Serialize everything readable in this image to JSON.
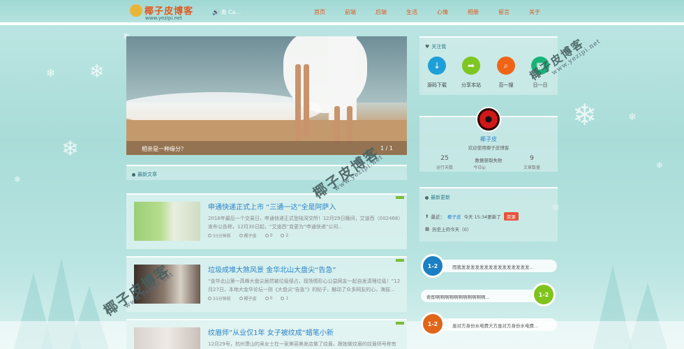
{
  "header": {
    "logo_title": "椰子皮博客",
    "logo_url": "www.yezipi.net",
    "music_text": "奥 Ca...",
    "nav": [
      "首页",
      "前端",
      "后端",
      "生活",
      "心情",
      "相册",
      "留言",
      "关于"
    ]
  },
  "slider": {
    "caption": "相亲是一种缘分？",
    "counter": "1 / 1"
  },
  "latest": {
    "title": "最新文章",
    "articles": [
      {
        "title": "申通快递正式上市 “三通一达”全是阿萨入",
        "excerpt": "2016年最后一个交易日，申通快递正式登陆深交所！12月29日晚间，艾迪西（002468）发布公告称，12月30日起，“艾迪西”变更为“申通快递”公司...",
        "time": "55分钟前",
        "author": "椰子皮",
        "views": "0",
        "comments": "2"
      },
      {
        "title": "垃圾成堆大煞风景 金华北山大盘尖“告急”",
        "excerpt": "“金华北山第一高峰大盘尖居然被垃圾侵占，现场情形心公益网友一起自发清理垃圾！”12月27日，本地大金华论坛一则《大盘尖“告急”》的帖子，触动了众多网友的心，海拔...",
        "time": "55分钟前",
        "author": "椰子皮",
        "views": "0",
        "comments": "1"
      },
      {
        "title": "纹眉师”从业仅1年 女子被纹成“蜡笔小新",
        "excerpt": "12月29号，杭州萧山的吴女士在一家美容美发店做了纹眉，跟她做纹眉的纹眉师号称有经",
        "time": "",
        "author": "",
        "views": "",
        "comments": ""
      }
    ]
  },
  "follow": {
    "title": "关注我",
    "items": [
      {
        "label": "源码下载",
        "icon": "download-icon",
        "color": "#1e9fd8",
        "glyph": "↓"
      },
      {
        "label": "分享本站",
        "icon": "share-icon",
        "color": "#7ec621",
        "glyph": "➦"
      },
      {
        "label": "百一搜",
        "icon": "search-icon",
        "color": "#f06417",
        "glyph": "⌕"
      },
      {
        "label": "日一日",
        "icon": "calendar-icon",
        "color": "#19b37a",
        "glyph": "▦"
      }
    ]
  },
  "profile": {
    "name": "椰子皮",
    "welcome": "欢迎使用椰子皮博客",
    "stats": [
      {
        "num": "25",
        "label": "运行天数"
      },
      {
        "num": "数据获取失败",
        "label": "今日ip"
      },
      {
        "num": "9",
        "label": "文章数量"
      }
    ]
  },
  "recent": {
    "title": "最新更新",
    "last_prefix": "最近：",
    "last_user": "椰子皮",
    "last_text": "今天 15:34更新了",
    "last_tag": "资源",
    "history": "历史上的今天（0）"
  },
  "comments": [
    {
      "badge": "1-2",
      "color": "#1b7fc4",
      "text": "而我发发发发发发发发发发发发发发发..."
    },
    {
      "badge": "1-2",
      "color": "#7fc31c",
      "text": "奇即啊啊啊啊啊啊啊啊啊啊啊..."
    },
    {
      "badge": "1-2",
      "color": "#e0661a",
      "text": "虽对方身份水电费大方虽对方身份水电费..."
    }
  ],
  "watermarks": {
    "text": "椰子皮博客",
    "url": "www.yezipi.net"
  }
}
